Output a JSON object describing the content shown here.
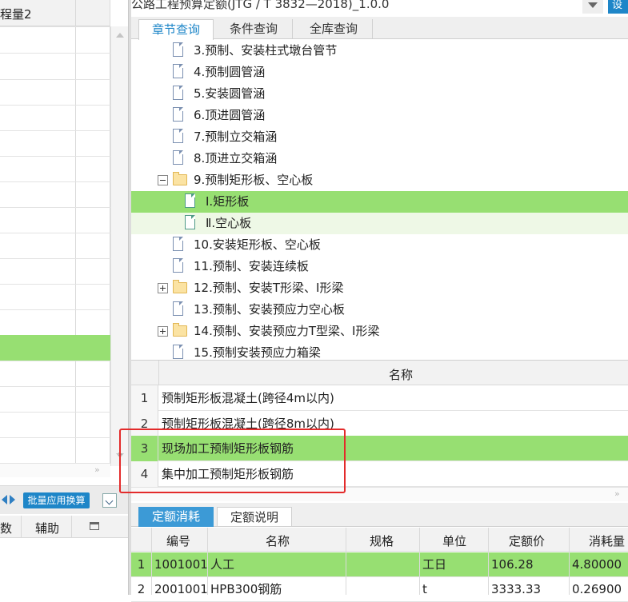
{
  "left_grid": {
    "header": "程量2",
    "toolbar_button": "批量应用换算",
    "bottom_headers": [
      "数",
      "辅助"
    ]
  },
  "quota_selector": {
    "value": "公路工程预算定额(JTG / T 3832—2018)_1.0.0",
    "right_button": "设"
  },
  "search_tabs": [
    "章节查询",
    "条件查询",
    "全库查询"
  ],
  "tree": [
    {
      "label": "3.预制、安装柱式墩台管节",
      "type": "doc"
    },
    {
      "label": "4.预制圆管涵",
      "type": "doc"
    },
    {
      "label": "5.安装圆管涵",
      "type": "doc"
    },
    {
      "label": "6.顶进圆管涵",
      "type": "doc"
    },
    {
      "label": "7.预制立交箱涵",
      "type": "doc"
    },
    {
      "label": "8.顶进立交箱涵",
      "type": "doc"
    },
    {
      "label": "9.预制矩形板、空心板",
      "type": "folder-open"
    },
    {
      "label": "Ⅰ.矩形板",
      "type": "doc",
      "state": "selected"
    },
    {
      "label": "Ⅱ.空心板",
      "type": "doc",
      "state": "hover"
    },
    {
      "label": "10.安装矩形板、空心板",
      "type": "doc"
    },
    {
      "label": "11.预制、安装连续板",
      "type": "doc"
    },
    {
      "label": "12.预制、安装T形梁、I形梁",
      "type": "folder-closed"
    },
    {
      "label": "13.预制、安装预应力空心板",
      "type": "doc"
    },
    {
      "label": "14.预制、安装预应力T型梁、I形梁",
      "type": "folder-closed"
    },
    {
      "label": "15.预制安装预应力箱梁",
      "type": "doc"
    }
  ],
  "items_table": {
    "header": "名称",
    "rows": [
      {
        "num": "1",
        "name": "预制矩形板混凝土(跨径4m以内)"
      },
      {
        "num": "2",
        "name": "预制矩形板混凝土(跨径8m以内)"
      },
      {
        "num": "3",
        "name": "现场加工预制矩形板钢筋"
      },
      {
        "num": "4",
        "name": "集中加工预制矩形板钢筋"
      }
    ]
  },
  "detail_tabs": [
    "定额消耗",
    "定额说明"
  ],
  "consumption_table": {
    "headers": [
      "编号",
      "名称",
      "规格",
      "单位",
      "定额价",
      "消耗量"
    ],
    "rows": [
      {
        "num": "1",
        "code": "1001001",
        "name": "人工",
        "spec": "",
        "unit": "工日",
        "price": "106.28",
        "qty": "4.80000"
      },
      {
        "num": "2",
        "code": "2001001",
        "name": "HPB300钢筋",
        "spec": "",
        "unit": "t",
        "price": "3333.33",
        "qty": "0.26900"
      }
    ]
  },
  "colors": {
    "selected_green": "#97df72",
    "hover_green": "#eef8e6",
    "tab_active": "#3c9ad6",
    "annotation_red": "#e32b2b"
  }
}
